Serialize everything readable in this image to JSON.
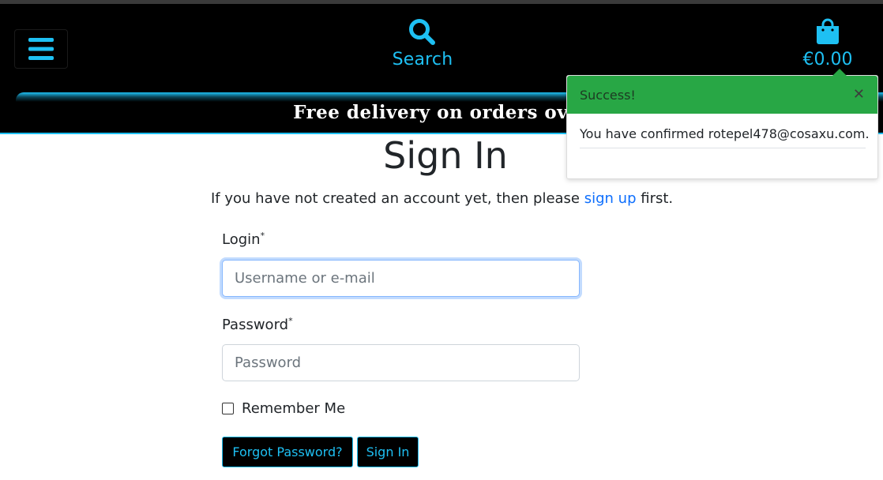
{
  "header": {
    "menu_icon": "hamburger-menu-icon",
    "search_icon": "search-icon",
    "search_label": "Search",
    "cart_icon": "shopping-bag-icon",
    "cart_total": "€0.00"
  },
  "banner": {
    "text": "Free delivery on orders over"
  },
  "main": {
    "title": "Sign In",
    "intro_before": "If you have not created an account yet, then please ",
    "intro_link": "sign up",
    "intro_after": " first.",
    "login_label": "Login",
    "login_placeholder": "Username or e-mail",
    "login_required": "*",
    "password_label": "Password",
    "password_placeholder": "Password",
    "password_required": "*",
    "remember_label": "Remember Me",
    "forgot_button": "Forgot Password?",
    "signin_button": "Sign In"
  },
  "toast": {
    "title": "Success!",
    "close_icon": "close-icon",
    "message": "You have confirmed rotepel478@cosaxu.com."
  },
  "colors": {
    "accent": "#1ec0f3",
    "header_bg": "#000000",
    "toast_header": "#28a745",
    "link": "#0d6efd"
  }
}
